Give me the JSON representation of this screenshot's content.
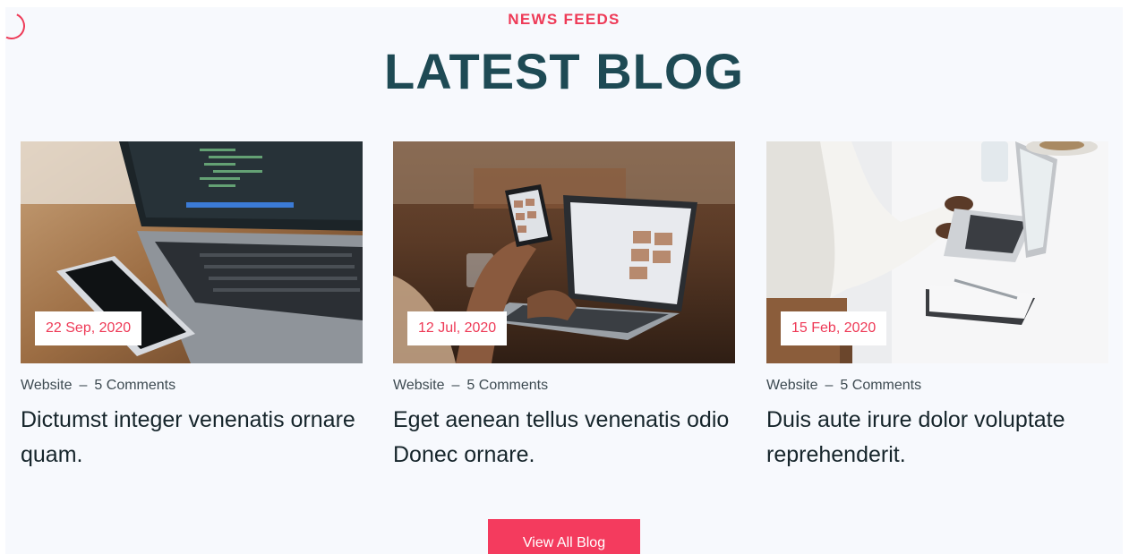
{
  "section": {
    "eyebrow": "NEWS FEEDS",
    "title": "LATEST BLOG"
  },
  "posts": [
    {
      "date": "22 Sep, 2020",
      "category": "Website",
      "separator": "–",
      "comments": "5 Comments",
      "title": "Dictumst integer venenatis ornare quam."
    },
    {
      "date": "12 Jul, 2020",
      "category": "Website",
      "separator": "–",
      "comments": "5 Comments",
      "title": "Eget aenean tellus venenatis odio Donec ornare."
    },
    {
      "date": "15 Feb, 2020",
      "category": "Website",
      "separator": "–",
      "comments": "5 Comments",
      "title": "Duis aute irure dolor voluptate reprehenderit."
    }
  ],
  "cta": {
    "label": "View All Blog"
  },
  "colors": {
    "accent": "#ee3a57",
    "button": "#f43b5e",
    "heading": "#1e4a54",
    "background": "#f7f9fd"
  },
  "icons": {
    "loader": "spinner-icon"
  }
}
